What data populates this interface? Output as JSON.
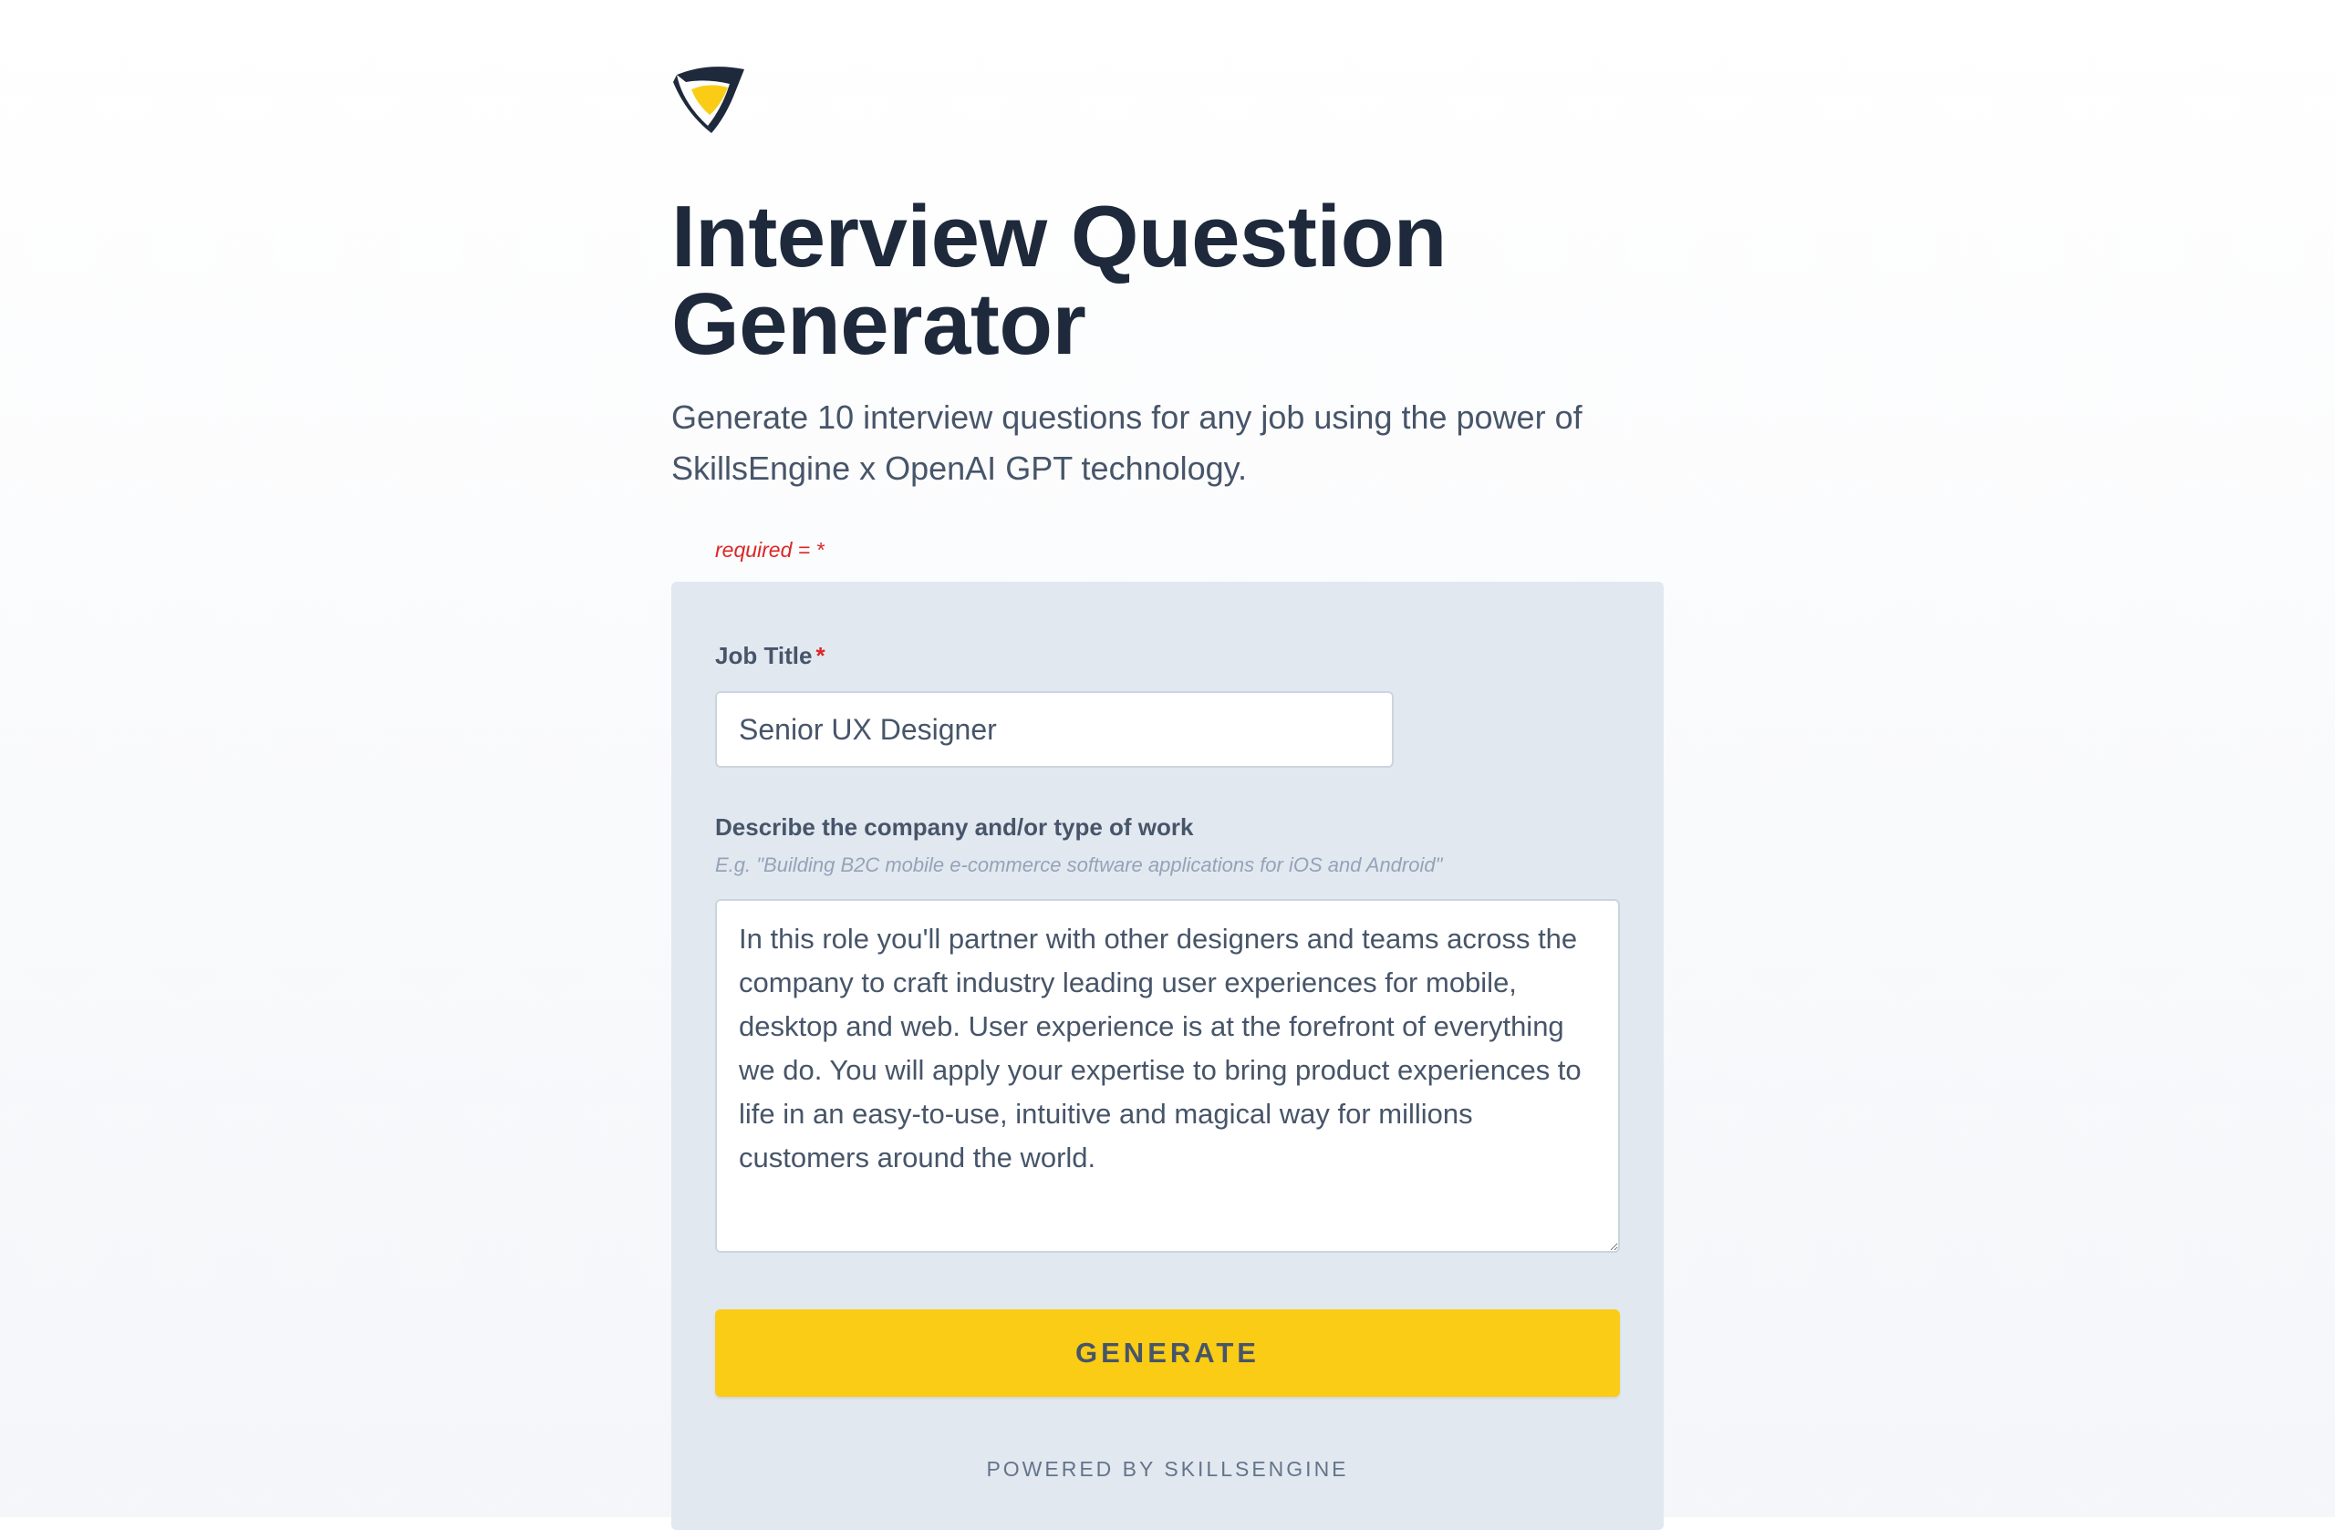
{
  "header": {
    "title": "Interview Question Generator",
    "subtitle": "Generate 10 interview questions for any job using the power of SkillsEngine x OpenAI GPT technology."
  },
  "logo": {
    "icon": "skillsengine-shield-logo",
    "colors": {
      "dark": "#1e293b",
      "accent": "#facc15"
    }
  },
  "form": {
    "required_note": "required = *",
    "job_title": {
      "label": "Job Title",
      "required_marker": "*",
      "value": "Senior UX Designer"
    },
    "description": {
      "label": "Describe the company and/or type of work",
      "hint": "E.g. \"Building B2C mobile e-commerce software applications for iOS and Android\"",
      "value": "In this role you'll partner with other designers and teams across the company to craft industry leading user experiences for mobile, desktop and web. User experience is at the forefront of everything we do. You will apply your expertise to bring product experiences to life in an easy-to-use, intuitive and magical way for millions customers around the world."
    },
    "generate_label": "GENERATE",
    "powered_by": "POWERED BY SKILLSENGINE"
  },
  "colors": {
    "accent": "#facc15",
    "required": "#dc2626",
    "card_bg": "#e2e8f0",
    "text_dark": "#1e293b"
  }
}
